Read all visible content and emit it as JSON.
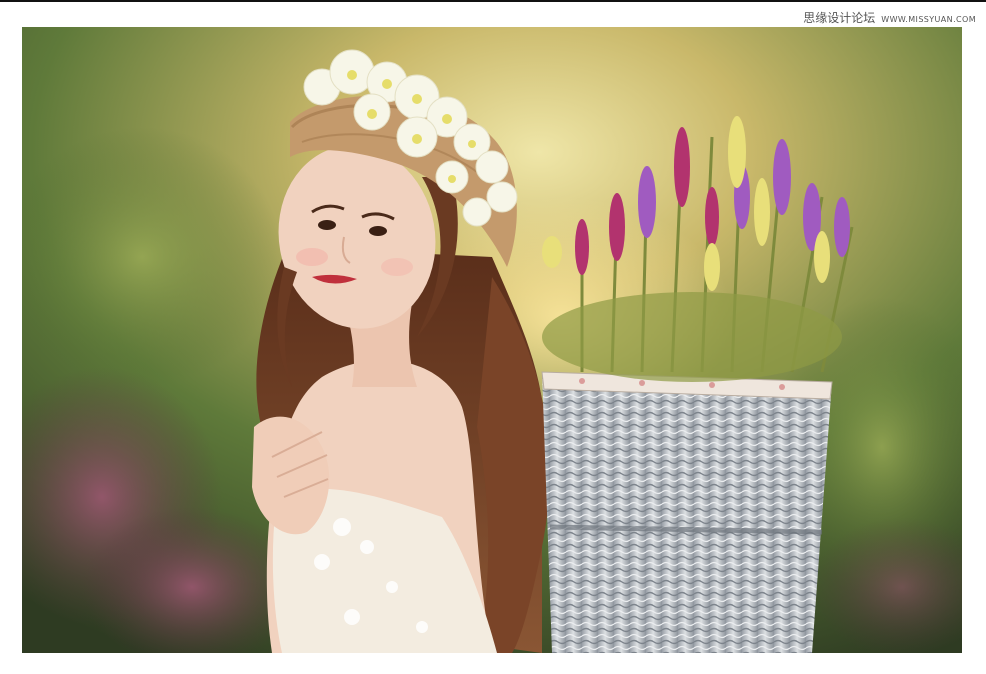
{
  "watermark": {
    "site_name": "思缘设计论坛",
    "url": "WWW.MISSYUAN.COM"
  },
  "photo": {
    "alt": "Woman in a flower-decorated straw hat beside a wicker basket of lavender and yellow flowers in a garden",
    "colors": {
      "background_warm": "#c9b86a",
      "background_green": "#5f7a3a",
      "background_dark": "#2e3b22",
      "bokeh_pink": "#8a4a60",
      "hat": "#c49a6c",
      "hat_flowers": "#f7f6e8",
      "hair": "#6a3a22",
      "skin": "#f1d2bf",
      "dress": "#f3ece0",
      "basket": "#cfd2d6",
      "basket_shadow": "#8d949c",
      "lavender_purple": "#a05bc0",
      "lavender_magenta": "#b2336e",
      "yellow_flowers": "#e8df7a",
      "stems": "#7e8a3c"
    }
  }
}
